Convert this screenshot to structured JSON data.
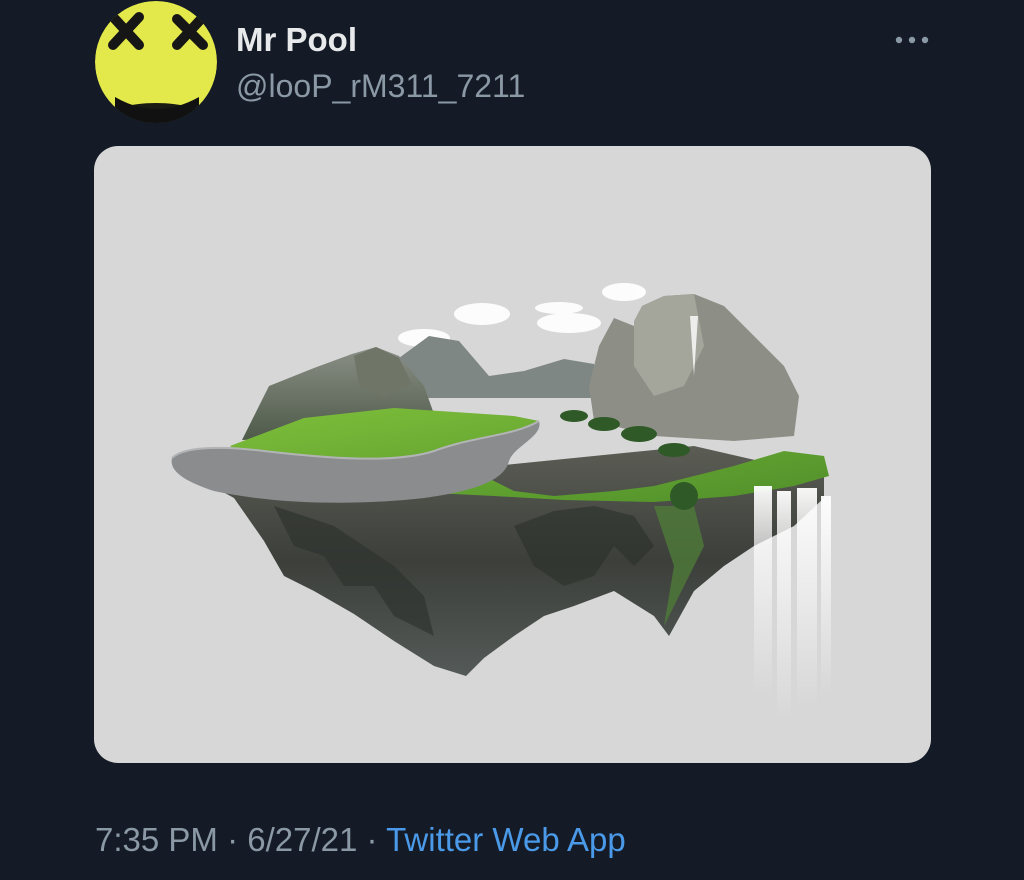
{
  "author": {
    "name": "Mr Pool",
    "handle": "@looP_rM311_7211",
    "avatar_icon": "yellow-dead-smiley-avatar"
  },
  "more_icon": "ellipsis-icon",
  "media": {
    "alt": "Floating island with road, grass, mountains and waterfall"
  },
  "meta": {
    "time": "7:35 PM",
    "sep1": " · ",
    "date": "6/27/21",
    "sep2": " · ",
    "source": "Twitter Web App"
  },
  "colors": {
    "background": "#141b26",
    "name": "#e7e9ea",
    "secondary": "#8b98a5",
    "link": "#4a9ae9",
    "media_bg": "#d7d7d8"
  }
}
